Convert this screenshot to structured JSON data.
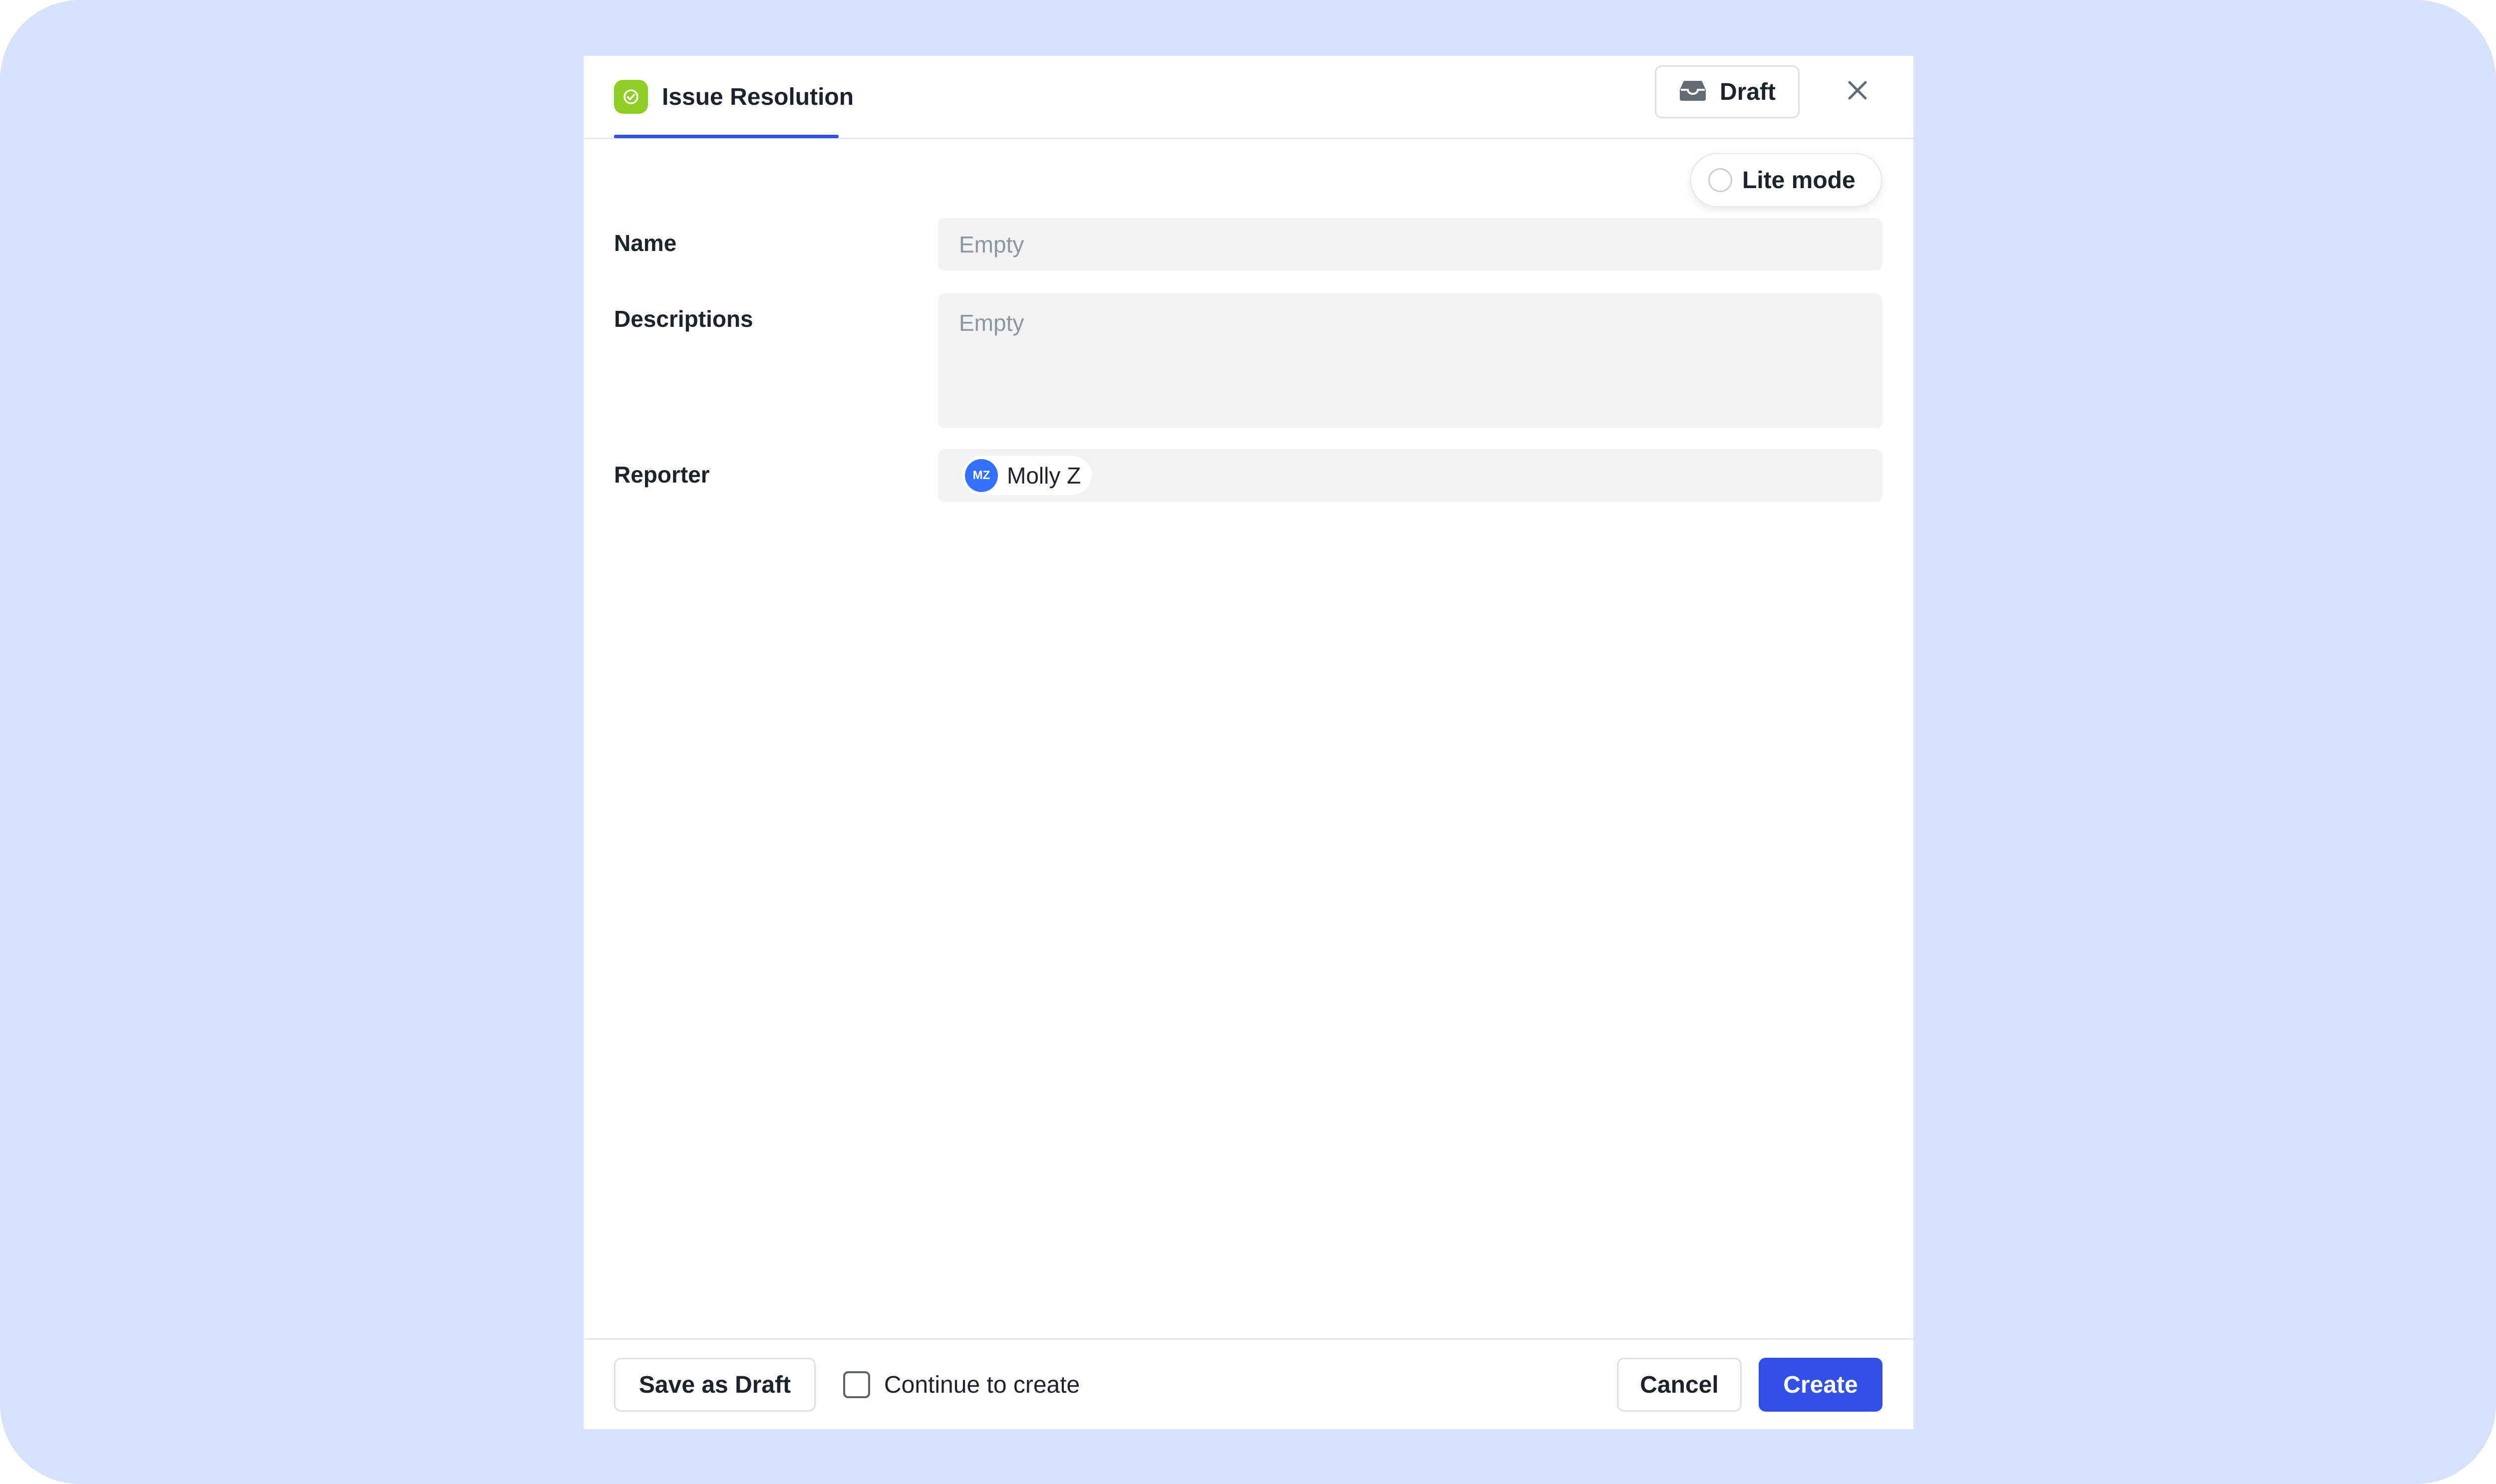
{
  "header": {
    "tab_title": "Issue Resolution",
    "tab_icon": "check-circle-icon",
    "draft_label": "Draft",
    "draft_icon": "inbox-icon",
    "close_icon": "close-icon"
  },
  "lite_mode": {
    "label": "Lite mode",
    "checked": false
  },
  "form": {
    "name": {
      "label": "Name",
      "placeholder": "Empty"
    },
    "descriptions": {
      "label": "Descriptions",
      "placeholder": "Empty"
    },
    "reporter": {
      "label": "Reporter",
      "user_name": "Molly Z",
      "user_initials": "MZ"
    }
  },
  "footer": {
    "save_draft_label": "Save as Draft",
    "continue_label": "Continue to create",
    "continue_checked": false,
    "cancel_label": "Cancel",
    "create_label": "Create"
  },
  "colors": {
    "accent": "#3250e8",
    "backdrop": "#d8e1fc",
    "tab_icon_bg": "#8fce25",
    "avatar_bg": "#3370ff"
  }
}
